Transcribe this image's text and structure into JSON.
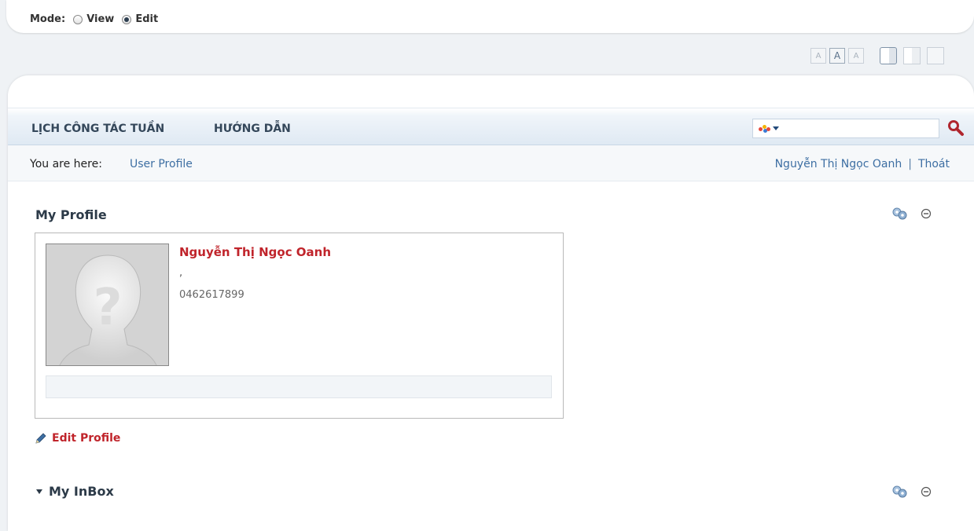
{
  "mode": {
    "label": "Mode:",
    "options": [
      {
        "label": "View",
        "selected": false
      },
      {
        "label": "Edit",
        "selected": true
      }
    ]
  },
  "toolbar": {
    "font_sizes": [
      "A",
      "A",
      "A"
    ],
    "active_font_size": 1,
    "layouts": [
      "layout-1-column",
      "layout-2-column",
      "layout-full"
    ]
  },
  "nav": {
    "items": [
      "LỊCH CÔNG TÁC TUẦN",
      "HƯỚNG DẪN"
    ],
    "search": {
      "placeholder": "",
      "value": "",
      "engine_icon": "search-engine-icon",
      "button_icon": "magnifier-icon"
    }
  },
  "breadcrumb": {
    "label": "You are here:",
    "link": "User Profile"
  },
  "user": {
    "name": "Nguyễn Thị Ngọc Oanh",
    "separator": "|",
    "logout": "Thoát"
  },
  "modules": {
    "profile": {
      "title": "My Profile",
      "name": "Nguyễn Thị Ngọc Oanh",
      "line2": ",",
      "phone": "0462617899",
      "edit_label": "Edit Profile"
    },
    "inbox": {
      "title": "My InBox"
    }
  },
  "colors": {
    "accent": "#c0242b",
    "link": "#3e6fa3",
    "nav_text": "#34475a"
  }
}
